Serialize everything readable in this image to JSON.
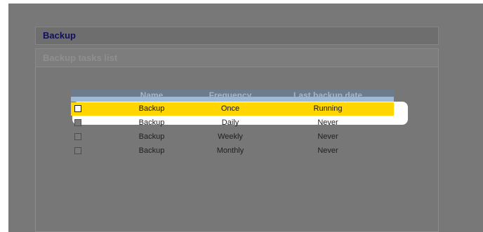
{
  "header": {
    "title": "Backup"
  },
  "panel": {
    "title": "Backup tasks list"
  },
  "table": {
    "columns": [
      "Name",
      "Frequency",
      "Last backup date"
    ],
    "rows": [
      {
        "name": "Backup",
        "frequency": "Once",
        "last": "Running",
        "selected": true
      },
      {
        "name": "Backup",
        "frequency": "Daily",
        "last": "Never",
        "selected": false
      },
      {
        "name": "Backup",
        "frequency": "Weekly",
        "last": "Never",
        "selected": false
      },
      {
        "name": "Backup",
        "frequency": "Monthly",
        "last": "Never",
        "selected": false
      }
    ]
  },
  "colors": {
    "highlight": "#ffd600",
    "overlay": "#787878",
    "header_band": "#6d7c8d"
  }
}
